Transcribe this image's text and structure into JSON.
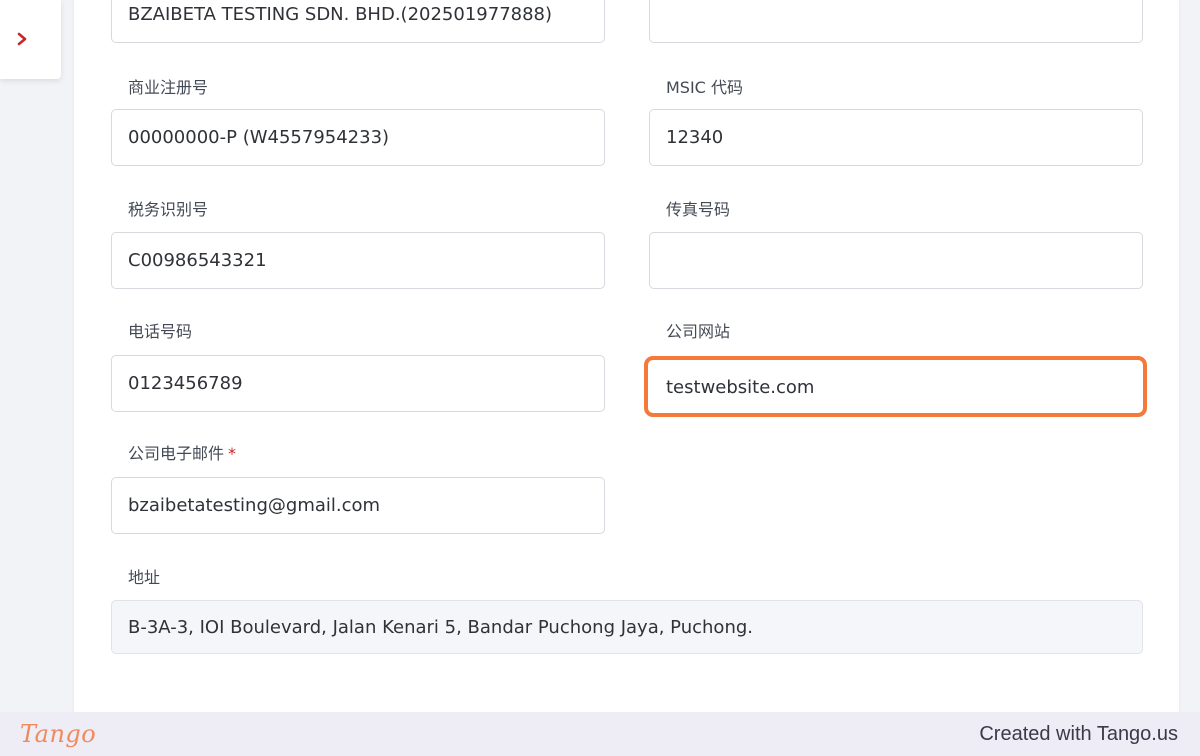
{
  "sidebar": {
    "toggle_icon": "chevron-right-icon",
    "accent_color": "#c62828"
  },
  "form": {
    "company_name": {
      "value": "BZAIBETA TESTING SDN. BHD.(202501977888)"
    },
    "top_right": {
      "value": ""
    },
    "business_reg_no": {
      "label": "商业注册号",
      "value": "00000000-P (W4557954233)"
    },
    "msic_code": {
      "label": "MSIC 代码",
      "value": "12340"
    },
    "tax_id": {
      "label": "税务识别号",
      "value": "C00986543321"
    },
    "fax_no": {
      "label": "传真号码",
      "value": ""
    },
    "phone_no": {
      "label": "电话号码",
      "value": "0123456789"
    },
    "website": {
      "label": "公司网站",
      "value": "testwebsite.com"
    },
    "email": {
      "label": "公司电子邮件",
      "required_mark": "*",
      "value": "bzaibetatesting@gmail.com"
    },
    "address": {
      "label": "地址",
      "value": "B-3A-3, IOI Boulevard, Jalan Kenari 5, Bandar Puchong Jaya, Puchong."
    }
  },
  "highlight_color": "#f4793b",
  "footer": {
    "logo_text": "Tango",
    "credit_text": "Created with Tango.us"
  }
}
